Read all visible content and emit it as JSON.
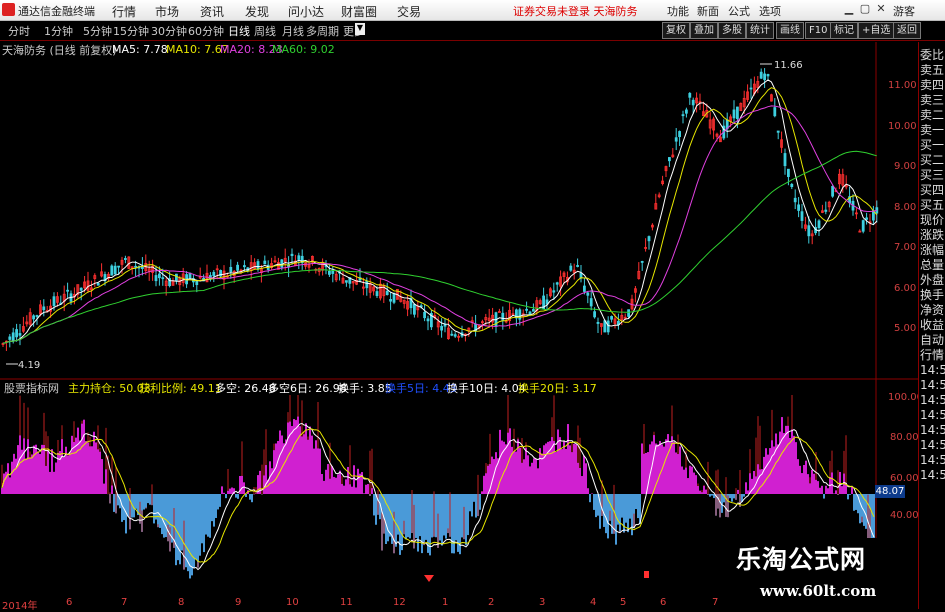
{
  "app": {
    "title": "通达信金融终端",
    "menus": [
      "行情",
      "市场",
      "资讯",
      "发现",
      "问小达",
      "财富圈",
      "交易"
    ],
    "warning": "证券交易未登录  天海防务",
    "right_menus": [
      "功能",
      "新面",
      "公式",
      "选项"
    ],
    "right_title": "游客",
    "win_buttons": [
      "▁",
      "▢",
      "✕"
    ]
  },
  "toolbar": {
    "periods": [
      "分时",
      "1分钟",
      "5分钟",
      "15分钟",
      "30分钟",
      "60分钟",
      "日线",
      "周线",
      "月线",
      "多周期",
      "更多"
    ],
    "active": "日线",
    "dropdown": "▼",
    "right_buttons": [
      "复权",
      "叠加",
      "多股",
      "统计",
      "画线",
      "F10",
      "标记",
      "+自选",
      "返回"
    ]
  },
  "price_panel": {
    "title": "天海防务 (日线 前复权)",
    "ma": [
      {
        "label": "MA5: 7.78",
        "color": "#ffffff"
      },
      {
        "label": "MA10: 7.67",
        "color": "#e6e600"
      },
      {
        "label": "MA20: 8.23",
        "color": "#e040e0"
      },
      {
        "label": "MA60: 9.02",
        "color": "#30d030"
      }
    ],
    "high_note": "11.66",
    "low_note": "4.19",
    "axis": [
      "11.00",
      "10.00",
      "9.00",
      "8.00",
      "7.00",
      "6.00",
      "5.00"
    ]
  },
  "indicator": {
    "name": "股票指标网",
    "items": [
      {
        "label": "主力持仓: 50.03",
        "color": "#e6e600"
      },
      {
        "label": "获利比例: 49.11",
        "color": "#e6e600"
      },
      {
        "label": "多空: 26.48",
        "color": "#ffffff"
      },
      {
        "label": "多空6日: 26.98",
        "color": "#ffffff"
      },
      {
        "label": "换手: 3.85",
        "color": "#ffffff"
      },
      {
        "label": "换手5日: 4.43",
        "color": "#2050ff"
      },
      {
        "label": "换手10日: 4.04",
        "color": "#ffffff"
      },
      {
        "label": "换手20日: 3.17",
        "color": "#e6e600"
      }
    ],
    "axis": [
      "100.00",
      "80.00",
      "60.00",
      "40.00"
    ],
    "badge": "48.07"
  },
  "side": [
    "委比",
    "卖五",
    "卖四",
    "卖三",
    "卖二",
    "卖一",
    "买一",
    "买二",
    "买三",
    "买四",
    "买五",
    "现价",
    "涨跌",
    "涨幅",
    "总量",
    "外盘",
    "换手",
    "净资",
    "收益",
    "自动",
    "行情",
    "14:50",
    "14:50",
    "14:50",
    "14:50",
    "14:50",
    "14:50",
    "14:50",
    "14:50"
  ],
  "dates": [
    "2014年",
    "6",
    "7",
    "8",
    "9",
    "10",
    "11",
    "12",
    "1",
    "2",
    "3",
    "4",
    "5",
    "6",
    "7",
    "8",
    "9"
  ],
  "watermark": {
    "big": "乐淘公式网",
    "small": "www.60lt.com"
  }
}
